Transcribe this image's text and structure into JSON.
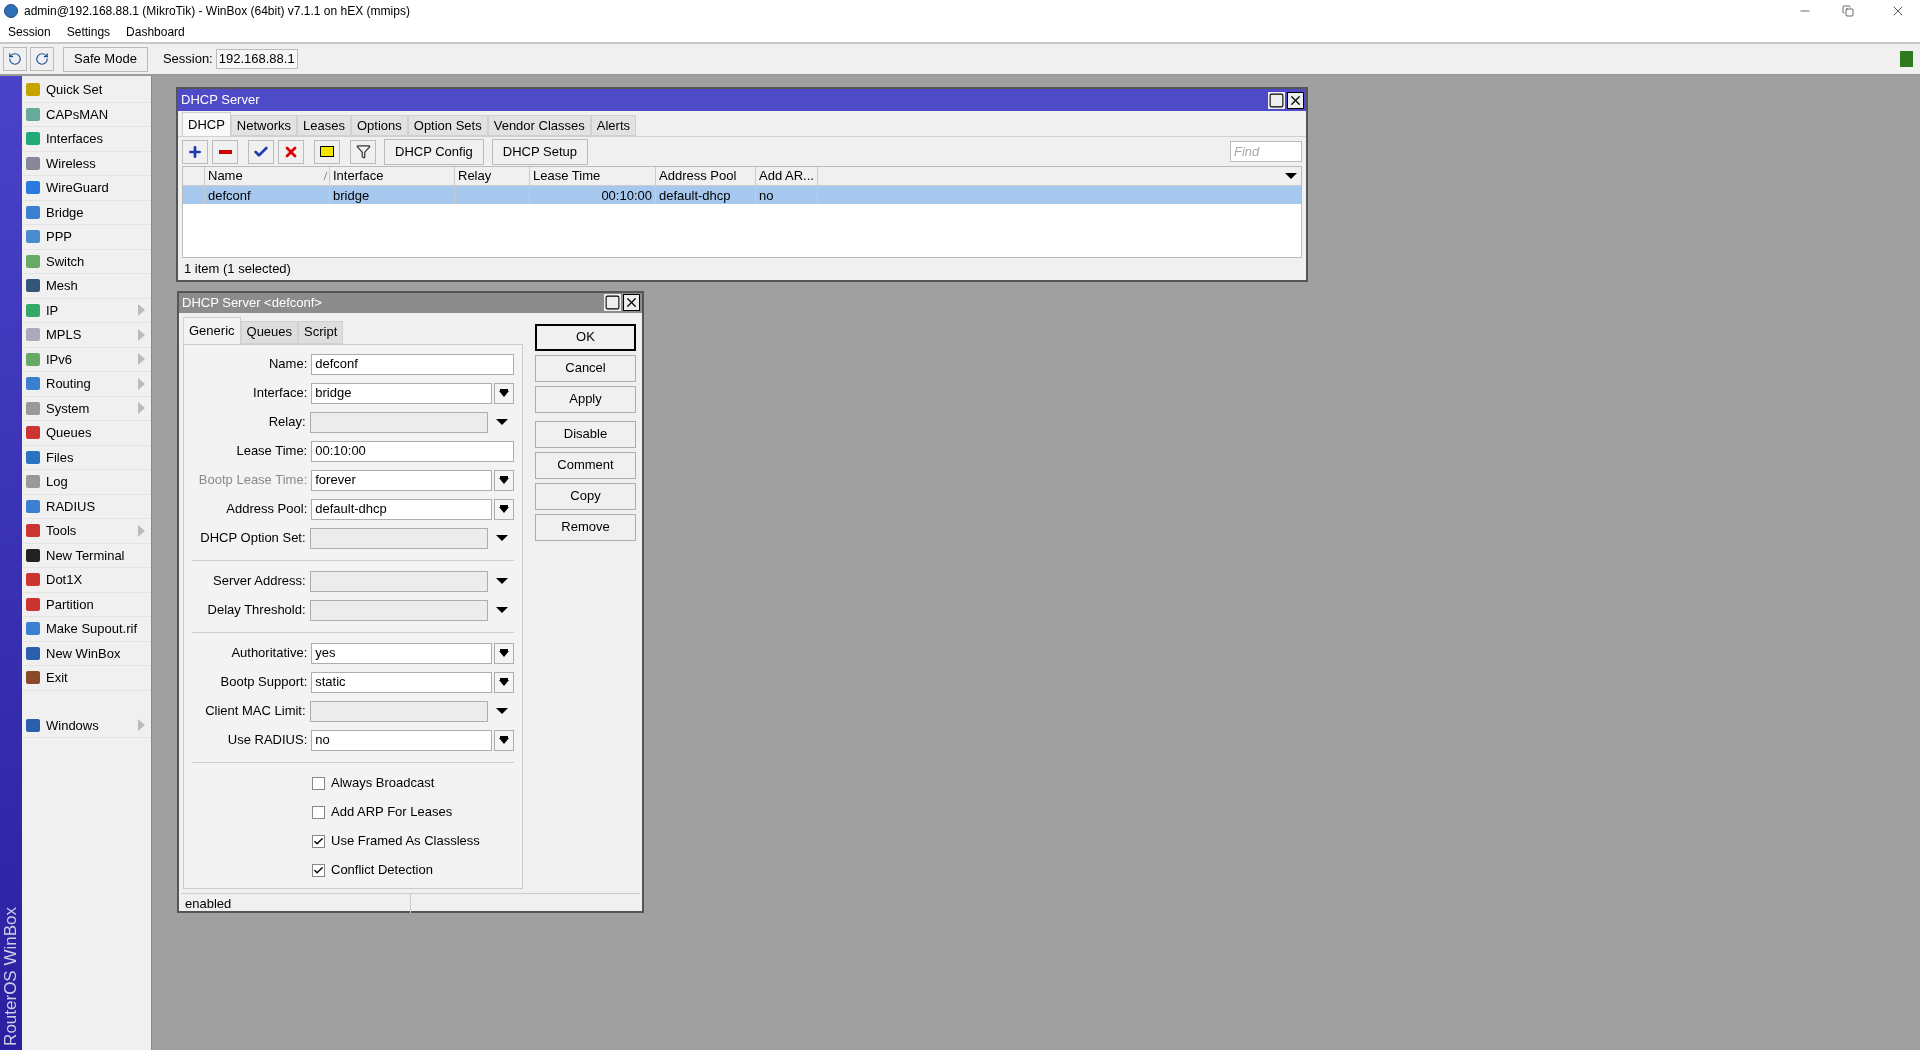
{
  "window": {
    "title": "admin@192.168.88.1 (MikroTik) - WinBox (64bit) v7.1.1 on hEX (mmips)"
  },
  "menu": [
    "Session",
    "Settings",
    "Dashboard"
  ],
  "toolbar": {
    "safe_mode": "Safe Mode",
    "session_label": "Session:",
    "session_value": "192.168.88.1"
  },
  "brand": "RouterOS WinBox",
  "sidebar": {
    "items": [
      {
        "label": "Quick Set",
        "has_submenu": false
      },
      {
        "label": "CAPsMAN",
        "has_submenu": false
      },
      {
        "label": "Interfaces",
        "has_submenu": false
      },
      {
        "label": "Wireless",
        "has_submenu": false
      },
      {
        "label": "WireGuard",
        "has_submenu": false
      },
      {
        "label": "Bridge",
        "has_submenu": false
      },
      {
        "label": "PPP",
        "has_submenu": false
      },
      {
        "label": "Switch",
        "has_submenu": false
      },
      {
        "label": "Mesh",
        "has_submenu": false
      },
      {
        "label": "IP",
        "has_submenu": true
      },
      {
        "label": "MPLS",
        "has_submenu": true
      },
      {
        "label": "IPv6",
        "has_submenu": true
      },
      {
        "label": "Routing",
        "has_submenu": true
      },
      {
        "label": "System",
        "has_submenu": true
      },
      {
        "label": "Queues",
        "has_submenu": false
      },
      {
        "label": "Files",
        "has_submenu": false
      },
      {
        "label": "Log",
        "has_submenu": false
      },
      {
        "label": "RADIUS",
        "has_submenu": false
      },
      {
        "label": "Tools",
        "has_submenu": true
      },
      {
        "label": "New Terminal",
        "has_submenu": false
      },
      {
        "label": "Dot1X",
        "has_submenu": false
      },
      {
        "label": "Partition",
        "has_submenu": false
      },
      {
        "label": "Make Supout.rif",
        "has_submenu": false
      },
      {
        "label": "New WinBox",
        "has_submenu": false
      },
      {
        "label": "Exit",
        "has_submenu": false
      }
    ],
    "bottom_item": {
      "label": "Windows",
      "has_submenu": true
    }
  },
  "dhcp_window": {
    "title": "DHCP Server",
    "tabs": [
      {
        "label": "DHCP",
        "selected": true
      },
      {
        "label": "Networks",
        "selected": false
      },
      {
        "label": "Leases",
        "selected": false
      },
      {
        "label": "Options",
        "selected": false
      },
      {
        "label": "Option Sets",
        "selected": false
      },
      {
        "label": "Vendor Classes",
        "selected": false
      },
      {
        "label": "Alerts",
        "selected": false
      }
    ],
    "buttons": [
      "DHCP Config",
      "DHCP Setup"
    ],
    "find_placeholder": "Find",
    "table": {
      "columns": [
        {
          "label": "Name",
          "sorted": true
        },
        {
          "label": "Interface",
          "sorted": false
        },
        {
          "label": "Relay",
          "sorted": false
        },
        {
          "label": "Lease Time",
          "sorted": false
        },
        {
          "label": "Address Pool",
          "sorted": false
        },
        {
          "label": "Add AR...",
          "sorted": false
        }
      ],
      "rows": [
        {
          "cells": [
            "defconf",
            "bridge",
            "",
            "00:10:00",
            "default-dhcp",
            "no"
          ],
          "selected": true
        }
      ]
    },
    "status": "1 item (1 selected)"
  },
  "dialog": {
    "title": "DHCP Server <defconf>",
    "tabs": [
      {
        "label": "Generic",
        "selected": true
      },
      {
        "label": "Queues",
        "selected": false
      },
      {
        "label": "Script",
        "selected": false
      }
    ],
    "field_groups": [
      [
        {
          "label": "Name:",
          "value": "defconf",
          "kind": "text",
          "disabled": false
        },
        {
          "label": "Interface:",
          "value": "bridge",
          "kind": "combo",
          "disabled": false
        },
        {
          "label": "Relay:",
          "kind": "dropdown",
          "disabled": false
        },
        {
          "label": "Lease Time:",
          "value": "00:10:00",
          "kind": "text",
          "disabled": false
        },
        {
          "label": "Bootp Lease Time:",
          "value": "forever",
          "kind": "combo",
          "disabled": true
        },
        {
          "label": "Address Pool:",
          "value": "default-dhcp",
          "kind": "combo",
          "disabled": false
        },
        {
          "label": "DHCP Option Set:",
          "kind": "dropdown",
          "disabled": false
        }
      ],
      [
        {
          "label": "Server Address:",
          "kind": "dropdown",
          "disabled": false
        },
        {
          "label": "Delay Threshold:",
          "kind": "dropdown",
          "disabled": false
        }
      ],
      [
        {
          "label": "Authoritative:",
          "value": "yes",
          "kind": "combo",
          "disabled": false
        },
        {
          "label": "Bootp Support:",
          "value": "static",
          "kind": "combo",
          "disabled": false
        },
        {
          "label": "Client MAC Limit:",
          "kind": "dropdown",
          "disabled": false
        },
        {
          "label": "Use RADIUS:",
          "value": "no",
          "kind": "combo",
          "disabled": false
        }
      ]
    ],
    "checkboxes": [
      {
        "label": "Always Broadcast",
        "checked": false
      },
      {
        "label": "Add ARP For Leases",
        "checked": false
      },
      {
        "label": "Use Framed As Classless",
        "checked": true
      },
      {
        "label": "Conflict Detection",
        "checked": true
      }
    ],
    "buttons": [
      {
        "label": "OK",
        "default": true
      },
      {
        "label": "Cancel",
        "default": false
      },
      {
        "label": "Apply",
        "default": false
      },
      {
        "label": "Disable",
        "default": false
      },
      {
        "label": "Comment",
        "default": false
      },
      {
        "label": "Copy",
        "default": false
      },
      {
        "label": "Remove",
        "default": false
      }
    ],
    "status": "enabled"
  }
}
